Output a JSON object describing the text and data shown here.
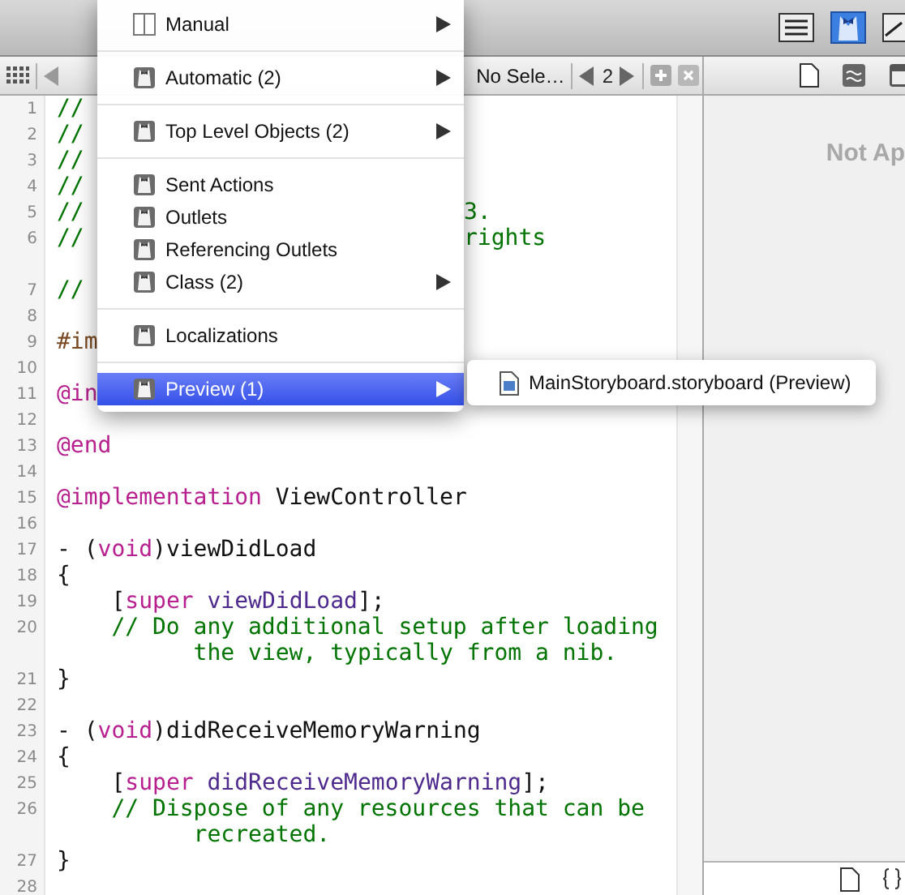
{
  "jump_bar": {
    "crumb": "No Sele…",
    "page": "2"
  },
  "code_lines": [
    {
      "number": "1",
      "segments": [
        {
          "text": "//",
          "kind": "comment"
        }
      ]
    },
    {
      "number": "2",
      "segments": [
        {
          "text": "//",
          "kind": "comment"
        }
      ]
    },
    {
      "number": "3",
      "segments": [
        {
          "text": "//",
          "kind": "comment"
        }
      ]
    },
    {
      "number": "4",
      "segments": [
        {
          "text": "//",
          "kind": "comment"
        }
      ]
    },
    {
      "number": "5",
      "segments": [
        {
          "text": "//",
          "kind": "comment"
        }
      ],
      "tail": {
        "text": "3.",
        "kind": "comment"
      }
    },
    {
      "number": "6",
      "segments": [
        {
          "text": "//",
          "kind": "comment"
        }
      ],
      "tail": {
        "text": "rights",
        "kind": "comment"
      },
      "wrapped": true
    },
    {
      "number": "7",
      "segments": [
        {
          "text": "//",
          "kind": "comment"
        }
      ]
    },
    {
      "number": "8"
    },
    {
      "number": "9",
      "segments": [
        {
          "text": "#im",
          "kind": "directive"
        }
      ]
    },
    {
      "number": "10"
    },
    {
      "number": "11",
      "segments": [
        {
          "text": "@in",
          "kind": "keyword"
        }
      ]
    },
    {
      "number": "12"
    },
    {
      "number": "13",
      "segments": [
        {
          "text": "@end",
          "kind": "keyword"
        }
      ]
    },
    {
      "number": "14"
    },
    {
      "number": "15",
      "segments": [
        {
          "text": "@implementation",
          "kind": "keyword"
        },
        {
          "text": " ViewController",
          "kind": "plain"
        }
      ]
    },
    {
      "number": "16"
    },
    {
      "number": "17",
      "segments": [
        {
          "text": "- (",
          "kind": "plain"
        },
        {
          "text": "void",
          "kind": "keyword"
        },
        {
          "text": ")viewDidLoad",
          "kind": "plain"
        }
      ]
    },
    {
      "number": "18",
      "segments": [
        {
          "text": "{",
          "kind": "plain"
        }
      ]
    },
    {
      "number": "19",
      "segments": [
        {
          "text": "    [",
          "kind": "plain"
        },
        {
          "text": "super",
          "kind": "keyword"
        },
        {
          "text": " viewDidLoad",
          "kind": "method"
        },
        {
          "text": "];",
          "kind": "plain"
        }
      ]
    },
    {
      "number": "20",
      "segments": [
        {
          "text": "    // Do any additional setup after loading",
          "kind": "comment"
        }
      ],
      "wrapped": true,
      "wrap": {
        "text": "the view, typically from a nib.",
        "kind": "comment"
      }
    },
    {
      "number": "21",
      "segments": [
        {
          "text": "}",
          "kind": "plain"
        }
      ]
    },
    {
      "number": "22"
    },
    {
      "number": "23",
      "segments": [
        {
          "text": "- (",
          "kind": "plain"
        },
        {
          "text": "void",
          "kind": "keyword"
        },
        {
          "text": ")didReceiveMemoryWarning",
          "kind": "plain"
        }
      ]
    },
    {
      "number": "24",
      "segments": [
        {
          "text": "{",
          "kind": "plain"
        }
      ]
    },
    {
      "number": "25",
      "segments": [
        {
          "text": "    [",
          "kind": "plain"
        },
        {
          "text": "super",
          "kind": "keyword"
        },
        {
          "text": " didReceiveMemoryWarning",
          "kind": "method"
        },
        {
          "text": "];",
          "kind": "plain"
        }
      ]
    },
    {
      "number": "26",
      "segments": [
        {
          "text": "    // Dispose of any resources that can be",
          "kind": "comment"
        }
      ],
      "wrapped": true,
      "wrap": {
        "text": "recreated.",
        "kind": "comment"
      }
    },
    {
      "number": "27",
      "segments": [
        {
          "text": "}",
          "kind": "plain"
        }
      ]
    },
    {
      "number": "28"
    }
  ],
  "inspector": {
    "message": "Not Ap"
  },
  "menu": [
    [
      {
        "label": "Manual",
        "submenu": true,
        "selected": false
      }
    ],
    [
      {
        "label": "Automatic (2)",
        "submenu": true,
        "selected": false
      }
    ],
    [
      {
        "label": "Top Level Objects (2)",
        "submenu": true,
        "selected": false
      }
    ],
    [
      {
        "label": "Sent Actions",
        "submenu": false,
        "selected": false
      },
      {
        "label": "Outlets",
        "submenu": false,
        "selected": false
      },
      {
        "label": "Referencing Outlets",
        "submenu": false,
        "selected": false
      },
      {
        "label": "Class (2)",
        "submenu": true,
        "selected": false
      }
    ],
    [
      {
        "label": "Localizations",
        "submenu": false,
        "selected": false
      }
    ],
    [
      {
        "label": "Preview (1)",
        "submenu": true,
        "selected": true
      }
    ]
  ],
  "submenu": [
    {
      "label": "MainStoryboard.storyboard (Preview)"
    }
  ]
}
